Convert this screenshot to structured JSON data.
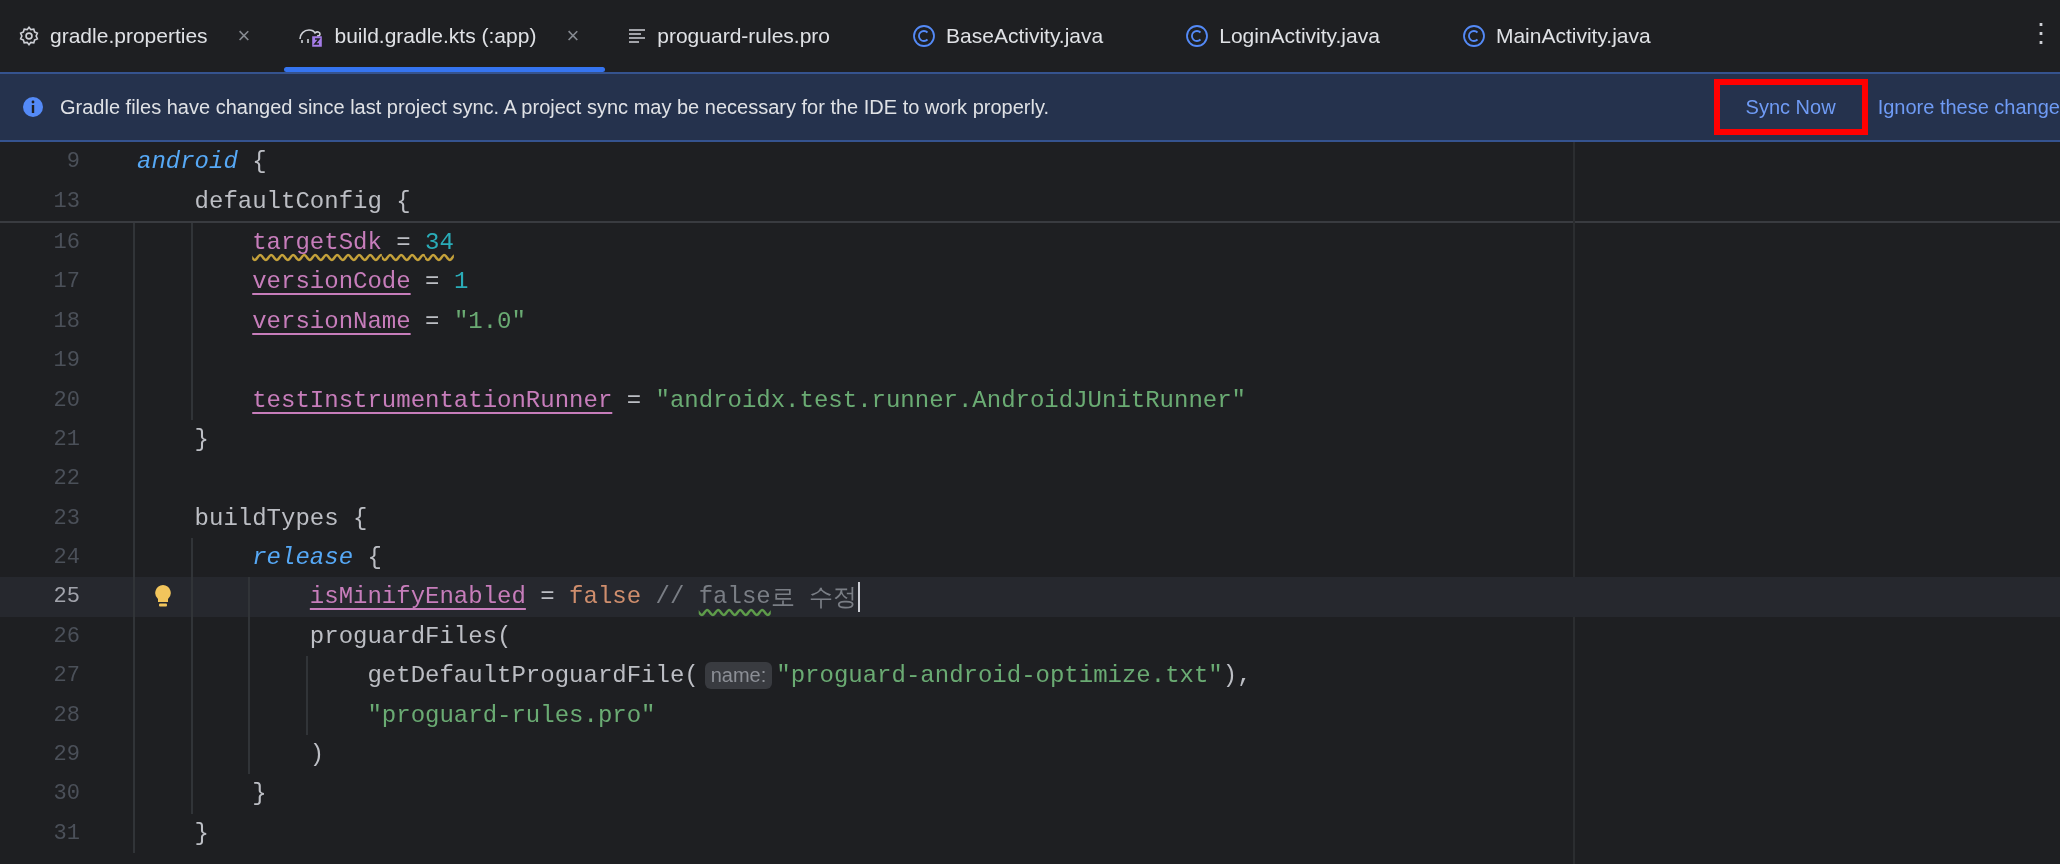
{
  "tabs": [
    {
      "label": "gradle.properties",
      "kind": "settings",
      "close": "×",
      "selected": false
    },
    {
      "label": "build.gradle.kts (:app)",
      "kind": "gradle",
      "close": "×",
      "selected": true
    },
    {
      "label": "proguard-rules.pro",
      "kind": "text",
      "selected": false
    },
    {
      "label": "BaseActivity.java",
      "kind": "class",
      "selected": false
    },
    {
      "label": "LoginActivity.java",
      "kind": "class",
      "selected": false
    },
    {
      "label": "MainActivity.java",
      "kind": "class",
      "selected": false
    }
  ],
  "more_menu": "⋮",
  "banner": {
    "message": "Gradle files have changed since last project sync. A project sync may be necessary for the IDE to work properly.",
    "actions": [
      {
        "label": "Sync Now",
        "highlighted": true
      },
      {
        "label": "Ignore these change",
        "highlighted": false
      }
    ]
  },
  "sticky_lines": [
    {
      "number": "9",
      "tokens": [
        {
          "text": "android",
          "kind": "keyword"
        },
        {
          "text": " {",
          "kind": "plain"
        }
      ]
    },
    {
      "number": "13",
      "tokens": [
        {
          "text": "    defaultConfig {",
          "kind": "plain"
        }
      ]
    }
  ],
  "lines": [
    {
      "number": "16",
      "current": false,
      "bulb": false,
      "caret": false,
      "tokens": [
        {
          "text": "        targetSdk",
          "kind": "prop",
          "warning": true
        },
        {
          "text": " = ",
          "kind": "plain",
          "warning": true
        },
        {
          "text": "34",
          "kind": "number",
          "warning": true
        }
      ]
    },
    {
      "number": "17",
      "current": false,
      "bulb": false,
      "caret": false,
      "tokens": [
        {
          "text": "        versionCode",
          "kind": "prop"
        },
        {
          "text": " = ",
          "kind": "plain"
        },
        {
          "text": "1",
          "kind": "number"
        }
      ]
    },
    {
      "number": "18",
      "current": false,
      "bulb": false,
      "caret": false,
      "tokens": [
        {
          "text": "        versionName",
          "kind": "prop"
        },
        {
          "text": " = ",
          "kind": "plain"
        },
        {
          "text": "\"1.0\"",
          "kind": "string"
        }
      ]
    },
    {
      "number": "19",
      "current": false,
      "bulb": false,
      "caret": false
    },
    {
      "number": "20",
      "current": false,
      "bulb": false,
      "caret": false,
      "tokens": [
        {
          "text": "        testInstrumentationRunner",
          "kind": "prop"
        },
        {
          "text": " = ",
          "kind": "plain"
        },
        {
          "text": "\"androidx.test.runner.AndroidJUnitRunner\"",
          "kind": "string"
        }
      ]
    },
    {
      "number": "21",
      "current": false,
      "bulb": false,
      "caret": false,
      "tokens": [
        {
          "text": "    }",
          "kind": "plain"
        }
      ]
    },
    {
      "number": "22",
      "current": false,
      "bulb": false,
      "caret": false
    },
    {
      "number": "23",
      "current": false,
      "bulb": false,
      "caret": false,
      "tokens": [
        {
          "text": "    buildTypes {",
          "kind": "plain"
        }
      ]
    },
    {
      "number": "24",
      "current": false,
      "bulb": false,
      "caret": false,
      "tokens": [
        {
          "text": "        release",
          "kind": "keyword"
        },
        {
          "text": " {",
          "kind": "plain"
        }
      ]
    },
    {
      "number": "25",
      "current": true,
      "bulb": true,
      "caret": true,
      "tokens": [
        {
          "text": "            isMinifyEnabled",
          "kind": "prop"
        },
        {
          "text": " = ",
          "kind": "plain"
        },
        {
          "text": "false",
          "kind": "literal"
        },
        {
          "text": " // ",
          "kind": "comment"
        },
        {
          "text": "false",
          "kind": "comment",
          "typo": true
        },
        {
          "text": "로 수정",
          "kind": "comment"
        }
      ]
    },
    {
      "number": "26",
      "current": false,
      "bulb": false,
      "caret": false,
      "tokens": [
        {
          "text": "            proguardFiles(",
          "kind": "plain"
        }
      ]
    },
    {
      "number": "27",
      "current": false,
      "bulb": false,
      "caret": false,
      "tokens": [
        {
          "text": "                getDefaultProguardFile(",
          "kind": "plain"
        },
        {
          "text": "name:",
          "kind": "hint"
        },
        {
          "text": "\"proguard-android-optimize.txt\"",
          "kind": "string"
        },
        {
          "text": "),",
          "kind": "plain"
        }
      ]
    },
    {
      "number": "28",
      "current": false,
      "bulb": false,
      "caret": false,
      "tokens": [
        {
          "text": "                \"proguard-rules.pro\"",
          "kind": "string"
        }
      ]
    },
    {
      "number": "29",
      "current": false,
      "bulb": false,
      "caret": false,
      "tokens": [
        {
          "text": "            )",
          "kind": "plain"
        }
      ]
    },
    {
      "number": "30",
      "current": false,
      "bulb": false,
      "caret": false,
      "tokens": [
        {
          "text": "        }",
          "kind": "plain"
        }
      ]
    },
    {
      "number": "31",
      "current": false,
      "bulb": false,
      "caret": false,
      "tokens": [
        {
          "text": "    }",
          "kind": "plain"
        }
      ]
    }
  ]
}
